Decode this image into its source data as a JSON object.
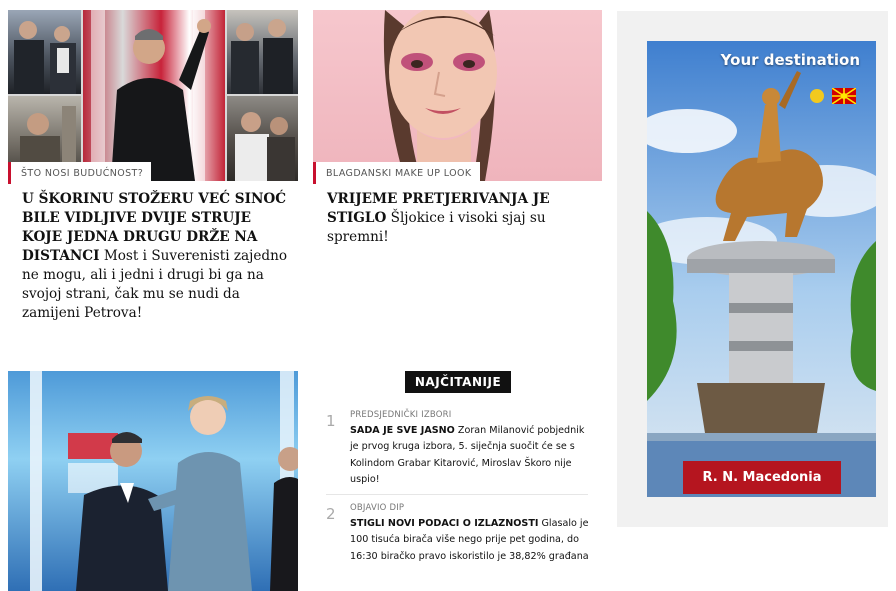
{
  "articles": [
    {
      "kicker": "ŠTO NOSI BUDUĆNOST?",
      "headline_bold": "U ŠKORINU STOŽERU VEĆ SINOĆ BILE VIDLJIVE DVIJE STRUJE KOJE JEDNA DRUGU DRŽE NA DISTANCI",
      "headline_rest": " Most i Suverenisti zajedno ne mogu, ali i jedni i drugi bi ga na svojoj strani, čak mu se nudi da zamijeni Petrova!"
    },
    {
      "kicker": "BLAGDANSKI MAKE UP LOOK",
      "headline_bold": "VRIJEME PRETJERIVANJA JE STIGLO",
      "headline_rest": " Šljokice i visoki sjaj su spremni!"
    }
  ],
  "most_read": {
    "title": "NAJČITANIJE",
    "items": [
      {
        "number": "1",
        "category": "PREDSJEDNIČKI IZBORI",
        "bold": "SADA JE SVE JASNO",
        "text": " Zoran Milanović pobjednik je prvog kruga izbora, 5. siječnja suočit će se s Kolindom Grabar Kitarović, Miroslav Škoro nije uspio!"
      },
      {
        "number": "2",
        "category": "OBJAVIO DIP",
        "bold": "STIGLI NOVI PODACI O IZLAZNOSTI",
        "text": " Glasalo je 100 tisuća birača više nego prije pet godina, do 16:30 biračko pravo iskoristilo je 38,82% građana"
      }
    ]
  },
  "ad": {
    "tagline": "Your destination",
    "cta": "R. N. Macedonia",
    "flags": [
      "mk-flag-icon",
      "smile-badge-icon"
    ]
  },
  "colors": {
    "accent": "#c8102e",
    "ad_button": "#b5151f",
    "sky": "#5d95d6",
    "pink_bg": "#f3c3c9"
  }
}
